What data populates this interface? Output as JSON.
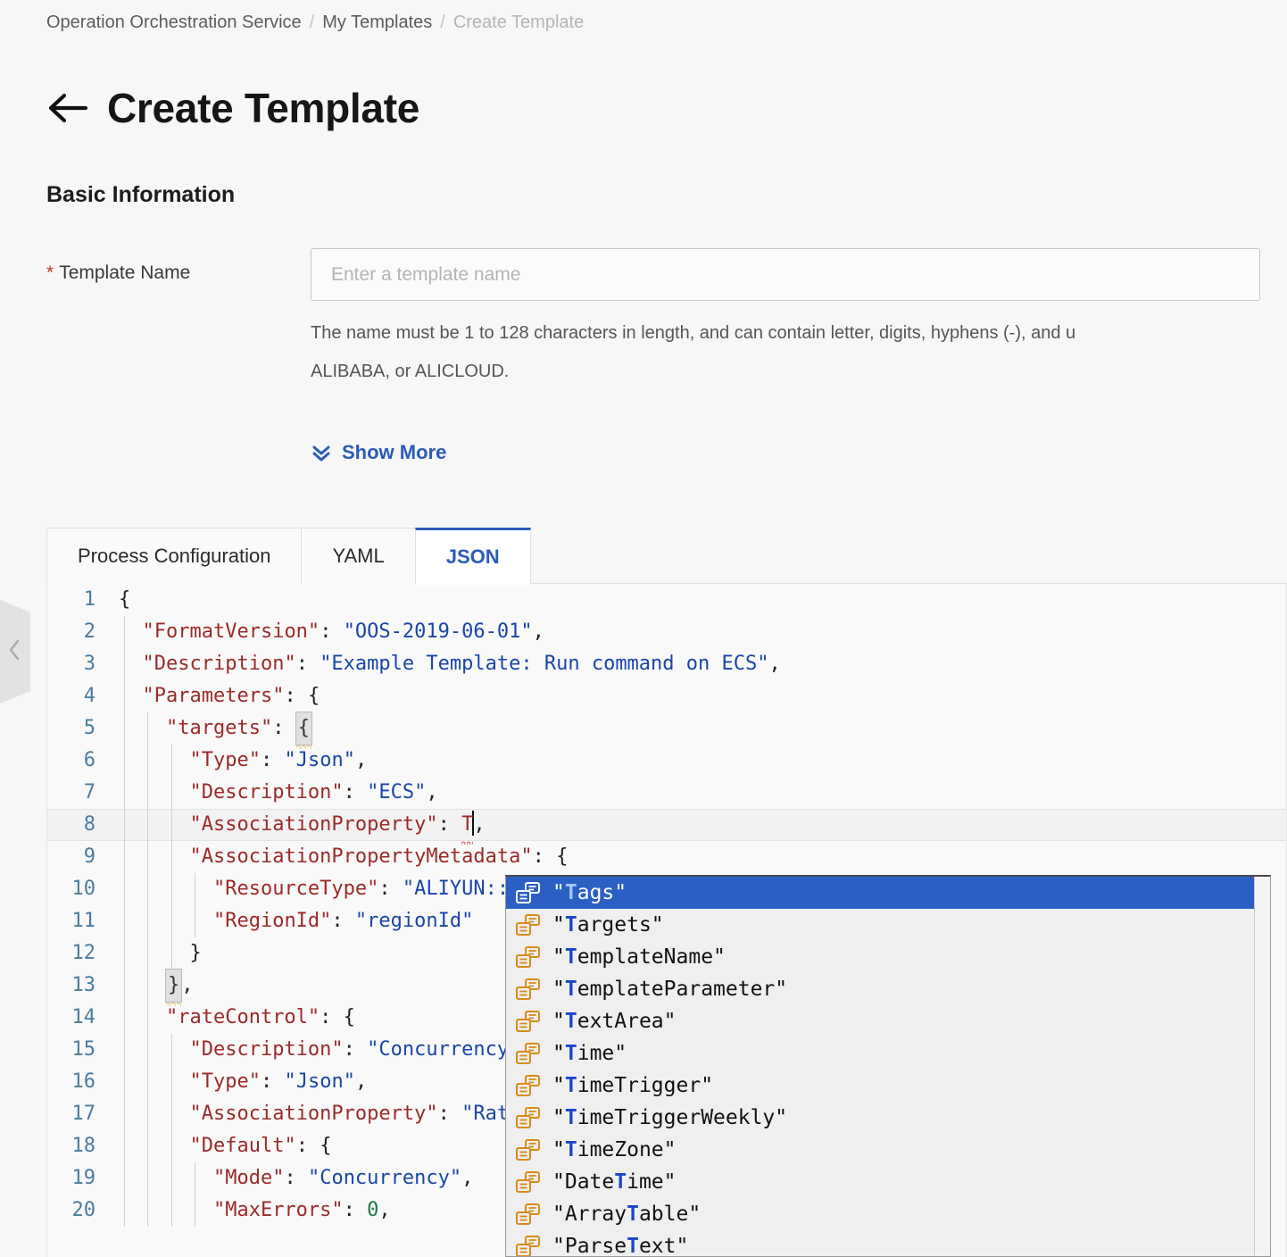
{
  "breadcrumb": {
    "items": [
      {
        "label": "Operation Orchestration Service",
        "current": false
      },
      {
        "label": "My Templates",
        "current": false
      },
      {
        "label": "Create Template",
        "current": true
      }
    ],
    "separator": "/"
  },
  "header": {
    "back_icon": "arrow-left-icon",
    "title": "Create Template"
  },
  "basic_information": {
    "section_title": "Basic Information",
    "template_name": {
      "required_mark": "*",
      "label": "Template Name",
      "value": "",
      "placeholder": "Enter a template name",
      "help_line_1": "The name must be 1 to 128 characters in length, and can contain letter, digits, hyphens (-), and u",
      "help_line_2": "ALIBABA, or ALICLOUD."
    },
    "show_more": {
      "label": "Show More",
      "icon": "double-chevron-down-icon"
    }
  },
  "tabs": [
    {
      "label": "Process Configuration",
      "active": false
    },
    {
      "label": "YAML",
      "active": false
    },
    {
      "label": "JSON",
      "active": true
    }
  ],
  "collapse_handle": {
    "icon": "chevron-left-icon"
  },
  "editor": {
    "language": "json",
    "current_line": 8,
    "lines": [
      {
        "n": "1",
        "tokens": [
          {
            "t": "p",
            "v": "{"
          }
        ]
      },
      {
        "n": "2",
        "indent": 1,
        "tokens": [
          {
            "t": "k",
            "v": "\"FormatVersion\""
          },
          {
            "t": "p",
            "v": ": "
          },
          {
            "t": "s",
            "v": "\"OOS-2019-06-01\""
          },
          {
            "t": "p",
            "v": ","
          }
        ]
      },
      {
        "n": "3",
        "indent": 1,
        "tokens": [
          {
            "t": "k",
            "v": "\"Description\""
          },
          {
            "t": "p",
            "v": ": "
          },
          {
            "t": "s",
            "v": "\"Example Template: Run command on ECS\""
          },
          {
            "t": "p",
            "v": ","
          }
        ]
      },
      {
        "n": "4",
        "indent": 1,
        "tokens": [
          {
            "t": "k",
            "v": "\"Parameters\""
          },
          {
            "t": "p",
            "v": ": {"
          }
        ]
      },
      {
        "n": "5",
        "indent": 2,
        "tokens": [
          {
            "t": "k",
            "v": "\"targets\""
          },
          {
            "t": "p",
            "v": ": "
          },
          {
            "t": "bmatch",
            "v": "{"
          }
        ]
      },
      {
        "n": "6",
        "indent": 3,
        "tokens": [
          {
            "t": "k",
            "v": "\"Type\""
          },
          {
            "t": "p",
            "v": ": "
          },
          {
            "t": "s",
            "v": "\"Json\""
          },
          {
            "t": "p",
            "v": ","
          }
        ]
      },
      {
        "n": "7",
        "indent": 3,
        "tokens": [
          {
            "t": "k",
            "v": "\"Description\""
          },
          {
            "t": "p",
            "v": ": "
          },
          {
            "t": "s",
            "v": "\"ECS\""
          },
          {
            "t": "p",
            "v": ","
          }
        ]
      },
      {
        "n": "8",
        "indent": 3,
        "current": true,
        "tokens": [
          {
            "t": "k",
            "v": "\"AssociationProperty\""
          },
          {
            "t": "p",
            "v": ": "
          },
          {
            "t": "err",
            "v": "T"
          },
          {
            "t": "caret",
            "v": ""
          },
          {
            "t": "p",
            "v": ","
          }
        ]
      },
      {
        "n": "9",
        "indent": 3,
        "tokens": [
          {
            "t": "k",
            "v": "\"AssociationPropertyMetadata\""
          },
          {
            "t": "p",
            "v": ": {"
          }
        ]
      },
      {
        "n": "10",
        "indent": 4,
        "tokens": [
          {
            "t": "k",
            "v": "\"ResourceType\""
          },
          {
            "t": "p",
            "v": ": "
          },
          {
            "t": "s",
            "v": "\"ALIYUN::ECS::Instance\""
          },
          {
            "t": "p",
            "v": ","
          }
        ]
      },
      {
        "n": "11",
        "indent": 4,
        "tokens": [
          {
            "t": "k",
            "v": "\"RegionId\""
          },
          {
            "t": "p",
            "v": ": "
          },
          {
            "t": "s",
            "v": "\"regionId\""
          }
        ]
      },
      {
        "n": "12",
        "indent": 3,
        "tokens": [
          {
            "t": "p",
            "v": "}"
          }
        ]
      },
      {
        "n": "13",
        "indent": 2,
        "tokens": [
          {
            "t": "bmatch",
            "v": "}"
          },
          {
            "t": "p",
            "v": ","
          }
        ]
      },
      {
        "n": "14",
        "indent": 2,
        "tokens": [
          {
            "t": "k",
            "v": "\"rateControl\""
          },
          {
            "t": "p",
            "v": ": {"
          }
        ]
      },
      {
        "n": "15",
        "indent": 3,
        "tokens": [
          {
            "t": "k",
            "v": "\"Description\""
          },
          {
            "t": "p",
            "v": ": "
          },
          {
            "t": "s",
            "v": "\"Concurrency\""
          },
          {
            "t": "p",
            "v": ","
          }
        ]
      },
      {
        "n": "16",
        "indent": 3,
        "tokens": [
          {
            "t": "k",
            "v": "\"Type\""
          },
          {
            "t": "p",
            "v": ": "
          },
          {
            "t": "s",
            "v": "\"Json\""
          },
          {
            "t": "p",
            "v": ","
          }
        ]
      },
      {
        "n": "17",
        "indent": 3,
        "tokens": [
          {
            "t": "k",
            "v": "\"AssociationProperty\""
          },
          {
            "t": "p",
            "v": ": "
          },
          {
            "t": "s",
            "v": "\"RateControl\""
          },
          {
            "t": "p",
            "v": ","
          }
        ]
      },
      {
        "n": "18",
        "indent": 3,
        "tokens": [
          {
            "t": "k",
            "v": "\"Default\""
          },
          {
            "t": "p",
            "v": ": {"
          }
        ]
      },
      {
        "n": "19",
        "indent": 4,
        "tokens": [
          {
            "t": "k",
            "v": "\"Mode\""
          },
          {
            "t": "p",
            "v": ": "
          },
          {
            "t": "s",
            "v": "\"Concurrency\""
          },
          {
            "t": "p",
            "v": ","
          }
        ]
      },
      {
        "n": "20",
        "indent": 4,
        "tokens": [
          {
            "t": "k",
            "v": "\"MaxErrors\""
          },
          {
            "t": "p",
            "v": ": "
          },
          {
            "t": "n",
            "v": "0"
          },
          {
            "t": "p",
            "v": ","
          }
        ]
      }
    ]
  },
  "autocomplete": {
    "icon_name": "property-snippet-icon",
    "selected_index": 0,
    "items": [
      {
        "prefix": "\"",
        "pre": "",
        "hl": "T",
        "post": "ags\""
      },
      {
        "prefix": "\"",
        "pre": "",
        "hl": "T",
        "post": "argets\""
      },
      {
        "prefix": "\"",
        "pre": "",
        "hl": "T",
        "post": "emplateName\""
      },
      {
        "prefix": "\"",
        "pre": "",
        "hl": "T",
        "post": "emplateParameter\""
      },
      {
        "prefix": "\"",
        "pre": "",
        "hl": "T",
        "post": "extArea\""
      },
      {
        "prefix": "\"",
        "pre": "",
        "hl": "T",
        "post": "ime\""
      },
      {
        "prefix": "\"",
        "pre": "",
        "hl": "T",
        "post": "imeTrigger\""
      },
      {
        "prefix": "\"",
        "pre": "",
        "hl": "T",
        "post": "imeTriggerWeekly\""
      },
      {
        "prefix": "\"",
        "pre": "",
        "hl": "T",
        "post": "imeZone\""
      },
      {
        "prefix": "\"",
        "pre": "Date",
        "hl": "T",
        "post": "ime\""
      },
      {
        "prefix": "\"",
        "pre": "Array",
        "hl": "T",
        "post": "able\""
      },
      {
        "prefix": "\"",
        "pre": "Parse",
        "hl": "T",
        "post": "ext\""
      }
    ]
  },
  "colors": {
    "accent": "#2a5bb8",
    "selection": "#2b5fc4",
    "json_key": "#9c2a2a",
    "json_string": "#1a45a8",
    "json_number": "#1a7a4a",
    "line_number": "#4a7c9e",
    "required_star": "#c8302a",
    "icon_orange": "#d98a18"
  }
}
